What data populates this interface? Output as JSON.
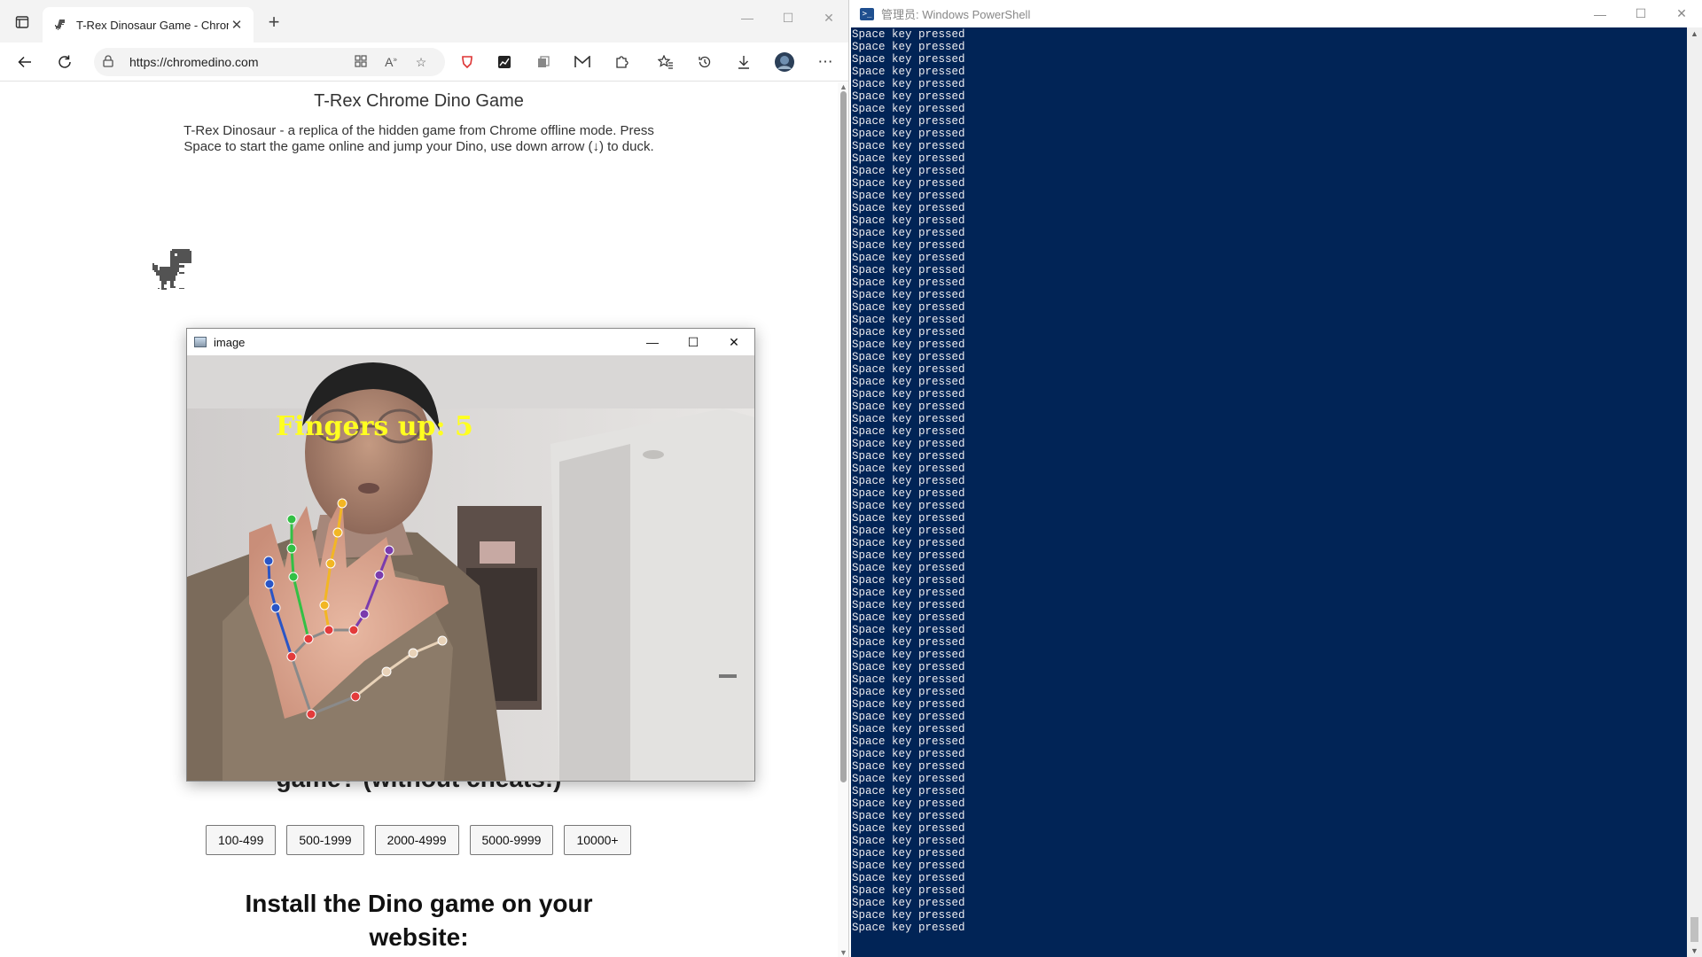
{
  "browser": {
    "tab_title": "T-Rex Dinosaur Game - Chrome",
    "url": "https://chromedino.com",
    "window_controls": {
      "minimize": "—",
      "maximize": "☐",
      "close": "✕"
    },
    "icons": [
      "workspaces-icon",
      "back-icon",
      "reload-icon",
      "lock-icon",
      "grid-icon",
      "read-aloud-icon",
      "add-favorite-icon",
      "extension-icon",
      "favorites-icon",
      "history-icon",
      "downloads-icon",
      "profile-icon",
      "more-icon"
    ]
  },
  "page": {
    "title": "T-Rex Chrome Dino Game",
    "description": "T-Rex Dinosaur - a replica of the hidden game from Chrome offline mode. Press Space to start the game online and jump your Dino, use down arrow (↓) to duck.",
    "partial_question": "game? (without cheats!)",
    "score_ranges": [
      "100-499",
      "500-1999",
      "2000-4999",
      "5000-9999",
      "10000+"
    ],
    "install_heading": "Install the Dino game on your website:"
  },
  "image_window": {
    "title": "image",
    "overlay_text": "Fingers up: 5",
    "controls": {
      "minimize": "—",
      "maximize": "☐",
      "close": "✕"
    },
    "landmark_colors": {
      "palm": "#e33b3b",
      "thumb": "#e8d2b8",
      "index": "#7a3cad",
      "middle": "#f2b624",
      "ring": "#33c045",
      "pinky": "#2a55c6",
      "overlay": "#ffff20"
    }
  },
  "powershell": {
    "title": "管理员: Windows PowerShell",
    "line_text": "Space key pressed",
    "line_count": 73,
    "background": "#012456",
    "controls": {
      "minimize": "—",
      "maximize": "☐",
      "close": "✕"
    }
  }
}
